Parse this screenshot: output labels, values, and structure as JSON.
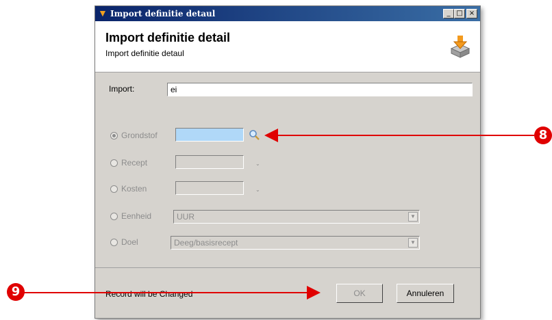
{
  "window": {
    "title": "Import definitie detaul",
    "controls": {
      "minimize": "_",
      "maximize": "□",
      "close": "×"
    }
  },
  "header": {
    "title": "Import definitie detail",
    "subtitle": "Import definitie detaul",
    "icon": "import-box-icon"
  },
  "form": {
    "import_label": "Import:",
    "import_value": "ei",
    "options": [
      {
        "label": "Grondstof",
        "selected": true
      },
      {
        "label": "Recept",
        "selected": false
      },
      {
        "label": "Kosten",
        "selected": false
      },
      {
        "label": "Eenheid",
        "selected": false,
        "value": "UUR"
      },
      {
        "label": "Doel",
        "selected": false,
        "value": "Deeg/basisrecept"
      }
    ]
  },
  "footer": {
    "status": "Record will be Changed",
    "ok_label": "OK",
    "cancel_label": "Annuleren"
  },
  "callouts": [
    "8",
    "9"
  ],
  "colors": {
    "callout": "#e00000",
    "title_bar": "#0a246a",
    "active_field": "#b0d8f8"
  }
}
